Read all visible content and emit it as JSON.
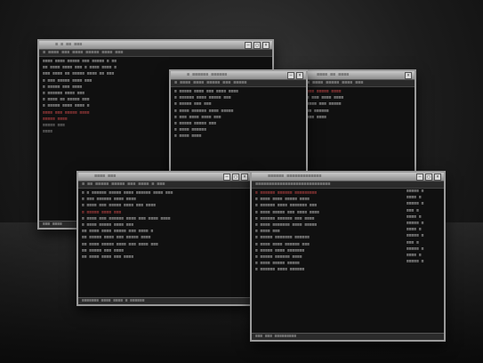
{
  "windows": {
    "w1": {
      "title": "≡ ≡ ≡≡ ≡≡≡",
      "menu": "≡ ≡≡≡≡ ≡≡≡ ≡≡≡≡ ≡≡≡≡≡ ≡≡≡≡ ≡≡≡",
      "lines": [
        {
          "text": "≡≡≡≡ ≡≡≡≡ ≡≡≡≡≡ ≡≡≡ ≡≡≡≡≡ ≡ ≡≡",
          "style": "normal"
        },
        {
          "text": "≡≡ ≡≡≡≡ ≡≡≡≡ ≡≡≡ ≡ ≡≡≡≡ ≡≡≡≡ ≡",
          "style": "normal"
        },
        {
          "text": "≡≡≡ ≡≡≡≡ ≡≡ ≡≡≡≡≡ ≡≡≡≡ ≡≡ ≡≡≡",
          "style": "normal"
        },
        {
          "text": "≡ ≡≡≡ ≡≡≡≡≡ ≡≡≡≡ ≡≡≡",
          "style": "normal"
        },
        {
          "text": "  ≡  ≡≡≡≡≡ ≡≡≡ ≡≡≡≡",
          "style": "normal"
        },
        {
          "text": "  ≡  ≡≡≡≡≡≡ ≡≡≡≡ ≡≡≡",
          "style": "normal"
        },
        {
          "text": "  ≡  ≡≡≡≡ ≡≡ ≡≡≡≡≡ ≡≡≡",
          "style": "normal"
        },
        {
          "text": "  ≡  ≡≡≡≡≡ ≡≡≡≡ ≡≡≡≡ ≡",
          "style": "normal"
        },
        {
          "text": "≡≡≡≡ ≡≡≡ ≡≡≡≡≡ ≡≡≡≡",
          "style": "red"
        },
        {
          "text": "≡≡≡≡≡ ≡≡≡≡",
          "style": "red"
        },
        {
          "text": "≡≡≡≡≡ ≡≡≡",
          "style": "dim"
        },
        {
          "text": "≡≡≡≡",
          "style": "dim"
        }
      ],
      "status": "≡≡≡ ≡≡≡≡"
    },
    "w2": {
      "title": "≡ ≡≡≡≡≡≡ ≡≡≡≡≡≡",
      "menu": "≡ ≡≡≡≡ ≡≡≡≡ ≡≡≡≡≡ ≡≡≡ ≡≡≡≡≡",
      "lines": [
        {
          "text": "≡ ≡≡≡≡≡ ≡≡≡≡ ≡≡≡ ≡≡≡≡ ≡≡≡≡",
          "style": "normal"
        },
        {
          "text": "≡ ≡≡≡≡≡≡ ≡≡≡≡ ≡≡≡≡≡ ≡≡≡",
          "style": "normal"
        },
        {
          "text": "≡ ≡≡≡≡≡ ≡≡≡ ≡≡≡",
          "style": "normal"
        },
        {
          "text": "≡ ≡≡≡≡ ≡≡≡≡≡≡ ≡≡≡≡ ≡≡≡≡≡",
          "style": "normal"
        },
        {
          "text": "≡ ≡≡≡ ≡≡≡≡ ≡≡≡≡ ≡≡≡",
          "style": "normal"
        },
        {
          "text": "≡ ≡≡≡≡≡ ≡≡≡≡≡ ≡≡≡",
          "style": "normal"
        },
        {
          "text": "≡ ≡≡≡≡ ≡≡≡≡≡≡",
          "style": "normal"
        },
        {
          "text": "≡ ≡≡≡≡ ≡≡≡≡",
          "style": "normal"
        }
      ]
    },
    "w3": {
      "title": "≡≡≡≡ ≡≡ ≡≡≡≡",
      "menu": "≡≡ ≡≡≡≡ ≡≡≡≡≡ ≡≡≡≡ ≡≡≡",
      "lines": [
        {
          "text": "≡≡≡≡ ≡≡≡≡≡ ≡≡≡≡",
          "style": "red"
        },
        {
          "text": "≡≡ ≡≡≡ ≡≡≡≡ ≡≡≡≡",
          "style": "normal"
        },
        {
          "text": "≡≡≡≡≡ ≡≡≡ ≡≡≡≡≡",
          "style": "normal"
        },
        {
          "text": "≡≡≡ ≡≡≡≡≡≡",
          "style": "normal"
        },
        {
          "text": "≡≡≡≡ ≡≡≡≡",
          "style": "normal"
        }
      ]
    },
    "w4": {
      "title": "≡≡≡≡ ≡≡≡",
      "menu": "≡ ≡≡ ≡≡≡≡≡ ≡≡≡≡≡ ≡≡≡ ≡≡≡≡ ≡ ≡≡≡",
      "lines": [
        {
          "text": "≡ ≡ ≡≡≡≡≡≡ ≡≡≡≡≡ ≡≡≡≡ ≡≡≡≡≡≡ ≡≡≡≡ ≡≡≡",
          "style": "normal"
        },
        {
          "text": "≡ ≡≡≡ ≡≡≡≡≡≡ ≡≡≡≡ ≡≡≡≡",
          "style": "normal"
        },
        {
          "text": "≡ ≡≡≡≡ ≡≡≡ ≡≡≡≡≡ ≡≡≡≡ ≡≡≡ ≡≡≡≡",
          "style": "normal"
        },
        {
          "text": "≡ ≡≡≡≡≡ ≡≡≡≡ ≡≡≡",
          "style": "red"
        },
        {
          "text": "≡ ≡≡≡≡ ≡≡≡ ≡≡≡≡≡≡ ≡≡≡≡ ≡≡≡ ≡≡≡≡ ≡≡≡≡",
          "style": "normal"
        },
        {
          "text": "≡ ≡≡≡≡ ≡≡≡≡≡ ≡≡≡≡ ≡≡≡",
          "style": "normal"
        },
        {
          "text": "  ≡≡ ≡≡≡≡ ≡≡≡≡ ≡≡≡≡≡ ≡≡≡ ≡≡≡≡ ≡",
          "style": "normal"
        },
        {
          "text": "  ≡≡ ≡≡≡≡≡ ≡≡≡≡ ≡≡≡ ≡≡≡≡≡ ≡≡≡≡",
          "style": "normal"
        },
        {
          "text": "  ≡≡ ≡≡≡≡ ≡≡≡≡≡ ≡≡≡≡ ≡≡≡ ≡≡≡≡ ≡≡≡",
          "style": "normal"
        },
        {
          "text": "  ≡≡ ≡≡≡≡≡ ≡≡≡ ≡≡≡≡",
          "style": "normal"
        },
        {
          "text": "  ≡≡ ≡≡≡≡ ≡≡≡≡ ≡≡≡ ≡≡≡≡",
          "style": "normal"
        }
      ],
      "status": "≡≡≡≡≡≡≡ ≡≡≡≡ ≡≡≡≡ ≡ ≡≡≡≡≡≡"
    },
    "w5": {
      "title": "≡≡≡≡≡≡ ≡≡≡≡≡≡≡≡≡≡≡≡≡",
      "menu": "≡≡≡≡≡≡≡≡≡≡≡≡≡≡≡≡≡≡≡≡≡≡≡≡≡≡≡≡",
      "lines": [
        {
          "text": "≡ ≡≡≡≡≡≡ ≡≡≡≡≡≡ ≡≡≡≡≡≡≡≡≡",
          "style": "red"
        },
        {
          "text": "≡ ≡≡≡≡ ≡≡≡≡ ≡≡≡≡≡ ≡≡≡≡",
          "style": "normal"
        },
        {
          "text": "≡ ≡≡≡≡≡≡ ≡≡≡≡ ≡≡≡≡≡≡≡ ≡≡≡",
          "style": "normal"
        },
        {
          "text": "≡ ≡≡≡≡ ≡≡≡≡≡ ≡≡≡ ≡≡≡≡ ≡≡≡≡",
          "style": "normal"
        },
        {
          "text": "≡ ≡≡≡≡≡≡ ≡≡≡≡≡≡ ≡≡≡ ≡≡≡≡",
          "style": "normal"
        },
        {
          "text": "≡ ≡≡≡≡ ≡≡≡≡≡≡≡ ≡≡≡≡ ≡≡≡≡≡",
          "style": "normal"
        },
        {
          "text": "≡ ≡≡≡≡ ≡≡≡",
          "style": "normal"
        },
        {
          "text": "≡ ≡≡≡≡≡ ≡≡≡≡≡≡≡ ≡≡≡≡≡≡",
          "style": "normal"
        },
        {
          "text": "≡ ≡≡≡≡ ≡≡≡≡ ≡≡≡≡≡≡ ≡≡≡",
          "style": "normal"
        },
        {
          "text": "≡ ≡≡≡≡≡ ≡≡≡≡ ≡≡≡≡≡≡≡",
          "style": "normal"
        },
        {
          "text": "≡ ≡≡≡≡≡ ≡≡≡≡≡≡ ≡≡≡≡",
          "style": "normal"
        },
        {
          "text": "≡ ≡≡≡≡ ≡≡≡≡≡ ≡≡≡≡≡",
          "style": "normal"
        },
        {
          "text": "≡ ≡≡≡≡≡≡ ≡≡≡≡ ≡≡≡≡≡≡",
          "style": "normal"
        }
      ],
      "side": [
        "≡≡≡≡≡ ≡",
        "≡≡≡≡ ≡",
        "≡≡≡≡≡ ≡",
        "≡≡≡ ≡",
        "≡≡≡≡ ≡",
        "≡≡≡≡≡ ≡",
        "≡≡≡≡ ≡",
        "≡≡≡≡≡ ≡",
        "≡≡≡ ≡",
        "≡≡≡≡≡ ≡",
        "≡≡≡≡ ≡",
        "≡≡≡≡≡ ≡"
      ],
      "status": "≡≡≡ ≡≡≡ ≡≡≡≡≡≡≡≡≡"
    }
  }
}
